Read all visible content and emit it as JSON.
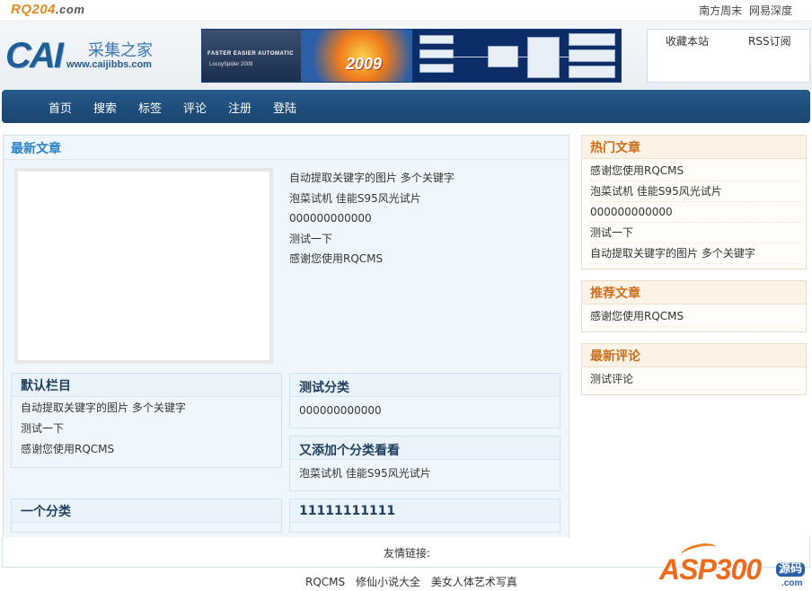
{
  "top": {
    "logo_main": "RQ204",
    "logo_suffix": ".com",
    "links": [
      "南方周末",
      "网易深度"
    ]
  },
  "header": {
    "logo_cai": "CAI",
    "logo_cn": "采集之家",
    "logo_url": "www.caijibbs.com",
    "banner_left": "FASTER  EASIER  AUTOMATIC",
    "banner_product": "LocoySpider 2009",
    "banner_year": "2009",
    "favorite_label": "收藏本站",
    "rss_label": "RSS订阅"
  },
  "nav": {
    "items": [
      "首页",
      "搜索",
      "标签",
      "评论",
      "注册",
      "登陆"
    ]
  },
  "latest": {
    "title": "最新文章",
    "items": [
      "自动提取关键字的图片 多个关键字",
      "泡菜试机 佳能S95风光试片",
      "000000000000",
      "测试一下",
      "感谢您使用RQCMS"
    ]
  },
  "categories": [
    {
      "title": "默认栏目",
      "items": [
        "自动提取关键字的图片 多个关键字",
        "测试一下",
        "感谢您使用RQCMS"
      ]
    },
    {
      "title": "测试分类",
      "items": [
        "000000000000"
      ]
    },
    {
      "title": "又添加个分类看看",
      "items": [
        "泡菜试机 佳能S95风光试片"
      ]
    },
    {
      "title": "一个分类",
      "items": []
    },
    {
      "title": "11111111111",
      "items": []
    }
  ],
  "sidebar": {
    "hot": {
      "title": "热门文章",
      "items": [
        "感谢您使用RQCMS",
        "泡菜试机 佳能S95风光试片",
        "000000000000",
        "测试一下",
        "自动提取关键字的图片 多个关键字"
      ]
    },
    "recommended": {
      "title": "推荐文章",
      "items": [
        "感谢您使用RQCMS"
      ]
    },
    "comments": {
      "title": "最新评论",
      "items": [
        "测试评论"
      ]
    }
  },
  "footer": {
    "friend_links_label": "友情链接:",
    "links": [
      "RQCMS",
      "修仙小说大全",
      "美女人体艺术写真"
    ]
  },
  "watermark": {
    "brand": "ASP300",
    "tag": "源码",
    "domain": ".com"
  }
}
